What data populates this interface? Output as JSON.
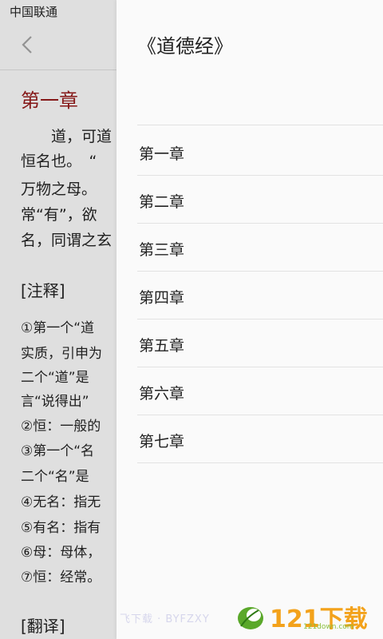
{
  "status_bar": {
    "carrier": "中国联通"
  },
  "reader": {
    "chapter_title": "第一章",
    "lines": [
      "　　道，可道",
      "恒名也。　“",
      "万物之母。",
      "常“有”，欲",
      "名，同谓之玄"
    ],
    "notes_title": "[注释]",
    "notes": [
      "①第一个“道",
      "实质，引申为",
      "二个“道”是",
      "言“说得出”",
      "②恒：一般的",
      "③第一个“名",
      "二个“名”是",
      "④无名：指无",
      "⑤有名：指有",
      "⑥母：母体，",
      "⑦恒：经常。"
    ],
    "translation_title": "[翻译]"
  },
  "drawer": {
    "title": "《道德经》",
    "items": [
      "第一章",
      "第二章",
      "第三章",
      "第四章",
      "第五章",
      "第六章",
      "第七章"
    ]
  },
  "watermark": {
    "text": "飞下载 · BYFZXY",
    "logo_main": "121下载站",
    "logo_sub": "121down.com"
  }
}
